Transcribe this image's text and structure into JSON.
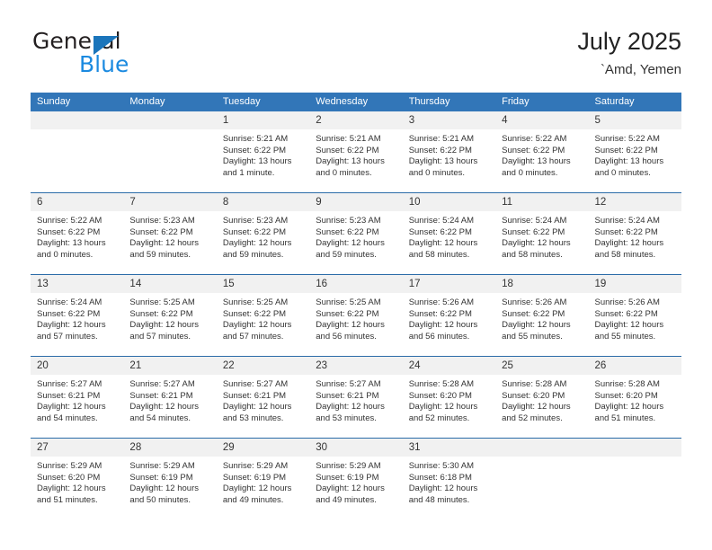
{
  "brand": {
    "word_one": "General",
    "word_two": "Blue",
    "triangle_icon": "triangle-logo-icon",
    "accent_dark": "#1b75bb",
    "accent_light": "#1b8ae0"
  },
  "header": {
    "title": "July 2025",
    "location": "`Amd, Yemen"
  },
  "theme": {
    "header_blue": "#3276b8",
    "row_divider_blue": "#2b6ca8",
    "day_band_gray": "#f1f1f1",
    "text": "#333333"
  },
  "calendar": {
    "weekdays": [
      "Sunday",
      "Monday",
      "Tuesday",
      "Wednesday",
      "Thursday",
      "Friday",
      "Saturday"
    ],
    "weeks": [
      [
        {
          "day": "",
          "lines": []
        },
        {
          "day": "",
          "lines": []
        },
        {
          "day": "1",
          "lines": [
            "Sunrise: 5:21 AM",
            "Sunset: 6:22 PM",
            "Daylight: 13 hours",
            "and 1 minute."
          ]
        },
        {
          "day": "2",
          "lines": [
            "Sunrise: 5:21 AM",
            "Sunset: 6:22 PM",
            "Daylight: 13 hours",
            "and 0 minutes."
          ]
        },
        {
          "day": "3",
          "lines": [
            "Sunrise: 5:21 AM",
            "Sunset: 6:22 PM",
            "Daylight: 13 hours",
            "and 0 minutes."
          ]
        },
        {
          "day": "4",
          "lines": [
            "Sunrise: 5:22 AM",
            "Sunset: 6:22 PM",
            "Daylight: 13 hours",
            "and 0 minutes."
          ]
        },
        {
          "day": "5",
          "lines": [
            "Sunrise: 5:22 AM",
            "Sunset: 6:22 PM",
            "Daylight: 13 hours",
            "and 0 minutes."
          ]
        }
      ],
      [
        {
          "day": "6",
          "lines": [
            "Sunrise: 5:22 AM",
            "Sunset: 6:22 PM",
            "Daylight: 13 hours",
            "and 0 minutes."
          ]
        },
        {
          "day": "7",
          "lines": [
            "Sunrise: 5:23 AM",
            "Sunset: 6:22 PM",
            "Daylight: 12 hours",
            "and 59 minutes."
          ]
        },
        {
          "day": "8",
          "lines": [
            "Sunrise: 5:23 AM",
            "Sunset: 6:22 PM",
            "Daylight: 12 hours",
            "and 59 minutes."
          ]
        },
        {
          "day": "9",
          "lines": [
            "Sunrise: 5:23 AM",
            "Sunset: 6:22 PM",
            "Daylight: 12 hours",
            "and 59 minutes."
          ]
        },
        {
          "day": "10",
          "lines": [
            "Sunrise: 5:24 AM",
            "Sunset: 6:22 PM",
            "Daylight: 12 hours",
            "and 58 minutes."
          ]
        },
        {
          "day": "11",
          "lines": [
            "Sunrise: 5:24 AM",
            "Sunset: 6:22 PM",
            "Daylight: 12 hours",
            "and 58 minutes."
          ]
        },
        {
          "day": "12",
          "lines": [
            "Sunrise: 5:24 AM",
            "Sunset: 6:22 PM",
            "Daylight: 12 hours",
            "and 58 minutes."
          ]
        }
      ],
      [
        {
          "day": "13",
          "lines": [
            "Sunrise: 5:24 AM",
            "Sunset: 6:22 PM",
            "Daylight: 12 hours",
            "and 57 minutes."
          ]
        },
        {
          "day": "14",
          "lines": [
            "Sunrise: 5:25 AM",
            "Sunset: 6:22 PM",
            "Daylight: 12 hours",
            "and 57 minutes."
          ]
        },
        {
          "day": "15",
          "lines": [
            "Sunrise: 5:25 AM",
            "Sunset: 6:22 PM",
            "Daylight: 12 hours",
            "and 57 minutes."
          ]
        },
        {
          "day": "16",
          "lines": [
            "Sunrise: 5:25 AM",
            "Sunset: 6:22 PM",
            "Daylight: 12 hours",
            "and 56 minutes."
          ]
        },
        {
          "day": "17",
          "lines": [
            "Sunrise: 5:26 AM",
            "Sunset: 6:22 PM",
            "Daylight: 12 hours",
            "and 56 minutes."
          ]
        },
        {
          "day": "18",
          "lines": [
            "Sunrise: 5:26 AM",
            "Sunset: 6:22 PM",
            "Daylight: 12 hours",
            "and 55 minutes."
          ]
        },
        {
          "day": "19",
          "lines": [
            "Sunrise: 5:26 AM",
            "Sunset: 6:22 PM",
            "Daylight: 12 hours",
            "and 55 minutes."
          ]
        }
      ],
      [
        {
          "day": "20",
          "lines": [
            "Sunrise: 5:27 AM",
            "Sunset: 6:21 PM",
            "Daylight: 12 hours",
            "and 54 minutes."
          ]
        },
        {
          "day": "21",
          "lines": [
            "Sunrise: 5:27 AM",
            "Sunset: 6:21 PM",
            "Daylight: 12 hours",
            "and 54 minutes."
          ]
        },
        {
          "day": "22",
          "lines": [
            "Sunrise: 5:27 AM",
            "Sunset: 6:21 PM",
            "Daylight: 12 hours",
            "and 53 minutes."
          ]
        },
        {
          "day": "23",
          "lines": [
            "Sunrise: 5:27 AM",
            "Sunset: 6:21 PM",
            "Daylight: 12 hours",
            "and 53 minutes."
          ]
        },
        {
          "day": "24",
          "lines": [
            "Sunrise: 5:28 AM",
            "Sunset: 6:20 PM",
            "Daylight: 12 hours",
            "and 52 minutes."
          ]
        },
        {
          "day": "25",
          "lines": [
            "Sunrise: 5:28 AM",
            "Sunset: 6:20 PM",
            "Daylight: 12 hours",
            "and 52 minutes."
          ]
        },
        {
          "day": "26",
          "lines": [
            "Sunrise: 5:28 AM",
            "Sunset: 6:20 PM",
            "Daylight: 12 hours",
            "and 51 minutes."
          ]
        }
      ],
      [
        {
          "day": "27",
          "lines": [
            "Sunrise: 5:29 AM",
            "Sunset: 6:20 PM",
            "Daylight: 12 hours",
            "and 51 minutes."
          ]
        },
        {
          "day": "28",
          "lines": [
            "Sunrise: 5:29 AM",
            "Sunset: 6:19 PM",
            "Daylight: 12 hours",
            "and 50 minutes."
          ]
        },
        {
          "day": "29",
          "lines": [
            "Sunrise: 5:29 AM",
            "Sunset: 6:19 PM",
            "Daylight: 12 hours",
            "and 49 minutes."
          ]
        },
        {
          "day": "30",
          "lines": [
            "Sunrise: 5:29 AM",
            "Sunset: 6:19 PM",
            "Daylight: 12 hours",
            "and 49 minutes."
          ]
        },
        {
          "day": "31",
          "lines": [
            "Sunrise: 5:30 AM",
            "Sunset: 6:18 PM",
            "Daylight: 12 hours",
            "and 48 minutes."
          ]
        },
        {
          "day": "",
          "lines": []
        },
        {
          "day": "",
          "lines": []
        }
      ]
    ]
  }
}
